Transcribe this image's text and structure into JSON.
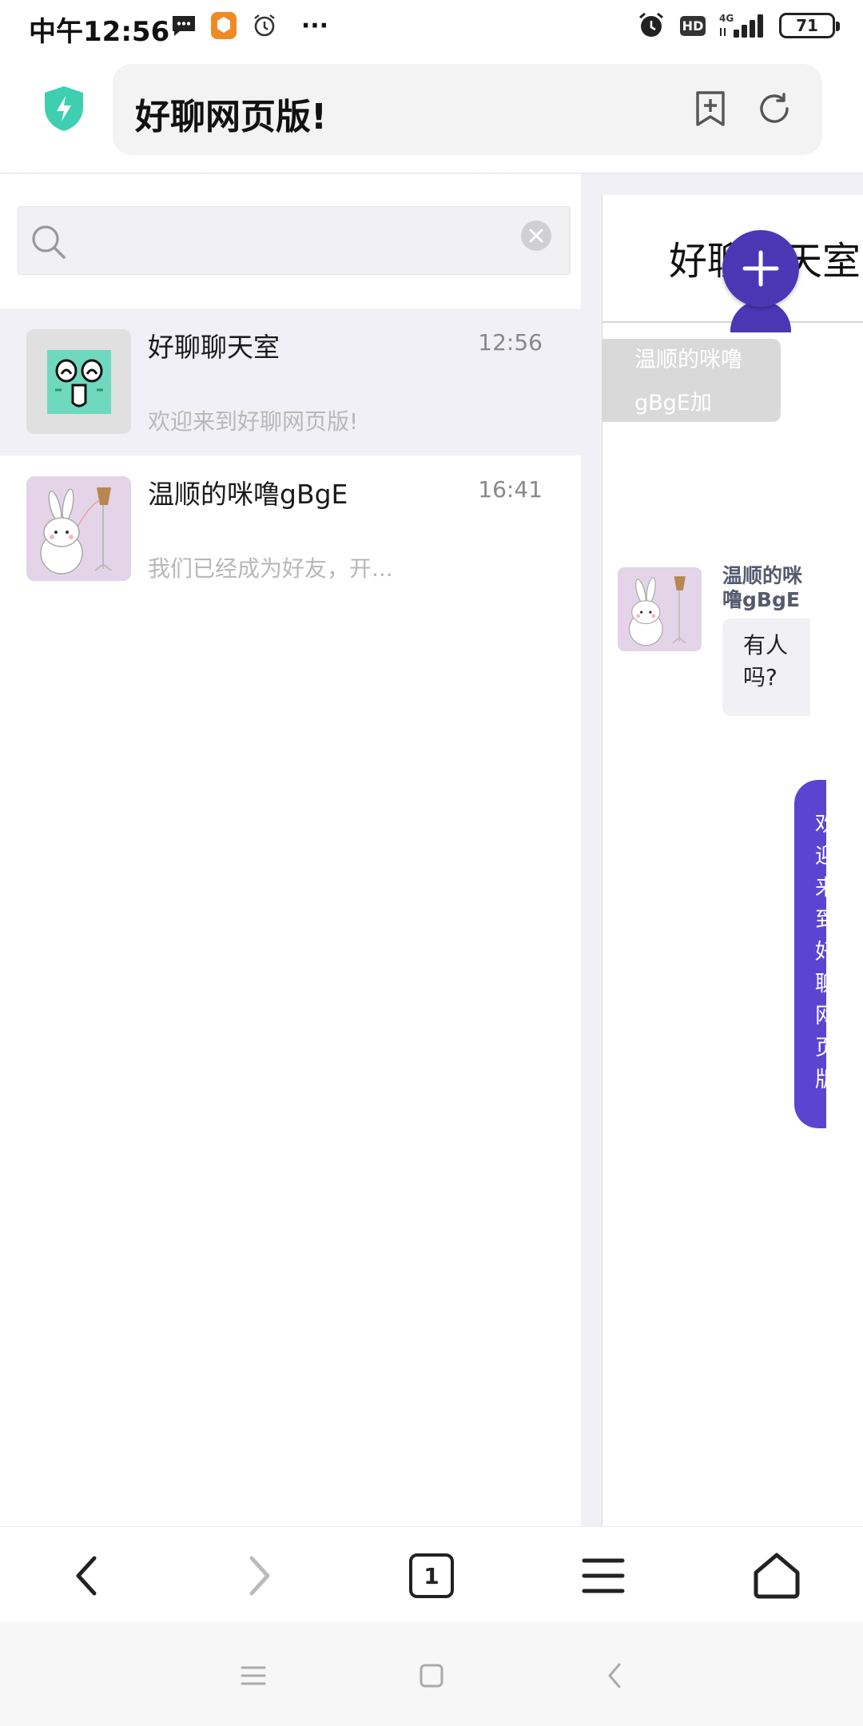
{
  "status_bar": {
    "time": "中午12:56",
    "battery": "71",
    "network": "4G",
    "hd_label": "HD",
    "more": "···"
  },
  "browser": {
    "title": "好聊网页版!",
    "tab_count": "1"
  },
  "search": {
    "placeholder": ""
  },
  "conversations": [
    {
      "name": "好聊聊天室",
      "time": "12:56",
      "preview": "欢迎来到好聊网页版!",
      "avatar": "green-emoji-face-icon",
      "active": true
    },
    {
      "name": "温顺的咪噜gBgE",
      "time": "16:41",
      "preview": "我们已经成为好友，开...",
      "avatar": "bunny-avatar-icon",
      "active": false
    }
  ],
  "chat": {
    "title": "好聊聊天室",
    "notice": "温顺的咪噜gBgE加",
    "incoming": {
      "sender": "温顺的咪噜gBgE",
      "text": "有人吗?"
    },
    "outgoing": {
      "text": "欢迎来到好聊网页版"
    }
  },
  "colors": {
    "accent": "#4b37b4",
    "outgoing_bubble": "#5b45d0",
    "shield": "#3ecfb0",
    "active_row": "#f1f0f6"
  }
}
